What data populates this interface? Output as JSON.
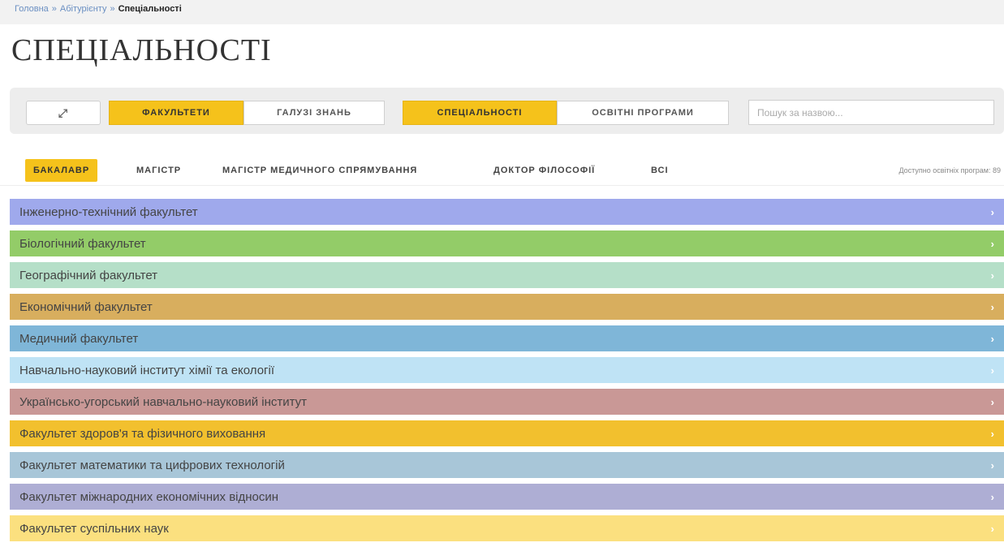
{
  "breadcrumb": {
    "items": [
      "Головна",
      "Абітурієнту"
    ],
    "separator": "»",
    "current": "Спеціальності"
  },
  "page": {
    "title": "СПЕЦІАЛЬНОСТІ"
  },
  "toolbar": {
    "expand_icon": "expand-arrows-icon",
    "expand_glyph": "⤢",
    "group_by": [
      {
        "label": "ФАКУЛЬТЕТИ",
        "active": true
      },
      {
        "label": "ГАЛУЗІ ЗНАНЬ",
        "active": false
      }
    ],
    "view_by": [
      {
        "label": "СПЕЦІАЛЬНОСТІ",
        "active": true
      },
      {
        "label": "ОСВІТНІ ПРОГРАМИ",
        "active": false
      }
    ],
    "search_placeholder": "Пошук за назвою..."
  },
  "levels": {
    "items": [
      {
        "label": "БАКАЛАВР",
        "active": true
      },
      {
        "label": "МАГІСТР",
        "active": false
      },
      {
        "label": "МАГІСТР МЕДИЧНОГО СПРЯМУВАННЯ",
        "active": false
      },
      {
        "label": "ДОКТОР ФІЛОСОФІЇ",
        "active": false
      },
      {
        "label": "ВСІ",
        "active": false
      }
    ],
    "available_text": "Доступно освітніх програм: 89"
  },
  "faculties": [
    {
      "name": "Інженерно-технічний факультет",
      "color": "#9fa9ec"
    },
    {
      "name": "Біологічний факультет",
      "color": "#93cc68"
    },
    {
      "name": "Географічний факультет",
      "color": "#b5dfc8"
    },
    {
      "name": "Економічний факультет",
      "color": "#d8ae5e"
    },
    {
      "name": "Медичний факультет",
      "color": "#7fb6d8"
    },
    {
      "name": "Навчально-науковий інститут хімії та екології",
      "color": "#bfe3f5"
    },
    {
      "name": "Українсько-угорський навчально-науковий інститут",
      "color": "#c99896"
    },
    {
      "name": "Факультет здоров'я та фізичного виховання",
      "color": "#f2c02e"
    },
    {
      "name": "Факультет математики та цифрових технологій",
      "color": "#a8c6d8"
    },
    {
      "name": "Факультет міжнародних економічних відносин",
      "color": "#aeaed4"
    },
    {
      "name": "Факультет суспільних наук",
      "color": "#fbe07f"
    }
  ],
  "chevron": "›"
}
